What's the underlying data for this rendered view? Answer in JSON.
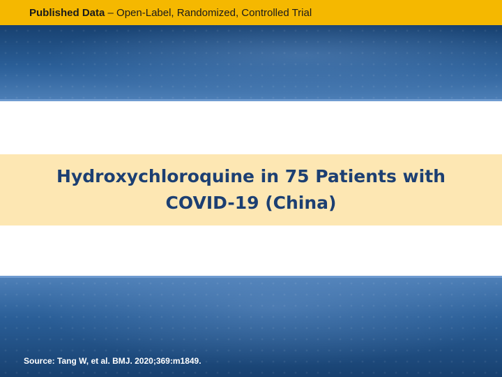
{
  "header": {
    "label_bold": "Published Data",
    "label_rest": " – Open-Label, Randomized, Controlled Trial"
  },
  "title": {
    "line1": "Hydroxychloroquine in 75 Patients with",
    "line2": "COVID-19 (China)"
  },
  "source": "Source: Tang W, et al. BMJ. 2020;369:m1849.",
  "colors": {
    "header_bar": "#f5b800",
    "band_blue": "#2b5f98",
    "title_band": "#fde7b3",
    "title_text": "#1c3f72"
  }
}
